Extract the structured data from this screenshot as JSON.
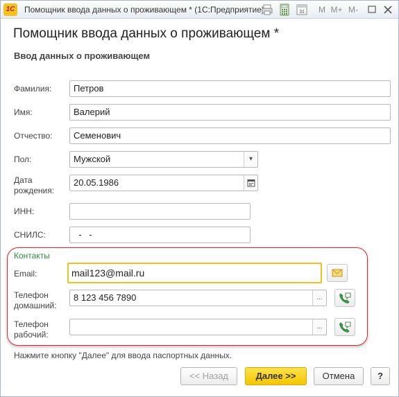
{
  "window": {
    "title": "Помощник ввода данных о проживающем *  (1С:Предприятие)",
    "app_logo": "1С",
    "toolbar": {
      "m": "M",
      "mplus": "M+",
      "mminus": "M-"
    }
  },
  "form": {
    "heading": "Помощник ввода данных о проживающем *",
    "subheading": "Ввод данных о проживающем",
    "surname": {
      "label": "Фамилия:",
      "value": "Петров"
    },
    "name": {
      "label": "Имя:",
      "value": "Валерий"
    },
    "patronymic": {
      "label": "Отчество:",
      "value": "Семенович"
    },
    "gender": {
      "label": "Пол:",
      "value": "Мужской"
    },
    "birthdate": {
      "label_line1": "Дата",
      "label_line2": "рождения:",
      "value": "20.05.1986"
    },
    "inn": {
      "label": "ИНН:",
      "value": ""
    },
    "snils": {
      "label": "СНИЛС:",
      "value": "  -   -"
    }
  },
  "contacts": {
    "title": "Контакты",
    "email": {
      "label": "Email:",
      "value": "mail123@mail.ru"
    },
    "home_phone": {
      "label_line1": "Телефон",
      "label_line2": "домашний:",
      "value": "8 123 456 7890"
    },
    "work_phone": {
      "label_line1": "Телефон",
      "label_line2": "рабочий:",
      "value": ""
    },
    "ellipsis": "..."
  },
  "hint": "Нажмите кнопку \"Далее\" для ввода паспортных данных.",
  "buttons": {
    "back": "<< Назад",
    "next": "Далее >>",
    "cancel": "Отмена",
    "help": "?"
  },
  "colors": {
    "accent_yellow": "#f3c600",
    "highlight_red": "#e0242a",
    "group_green": "#2e8b3d"
  }
}
